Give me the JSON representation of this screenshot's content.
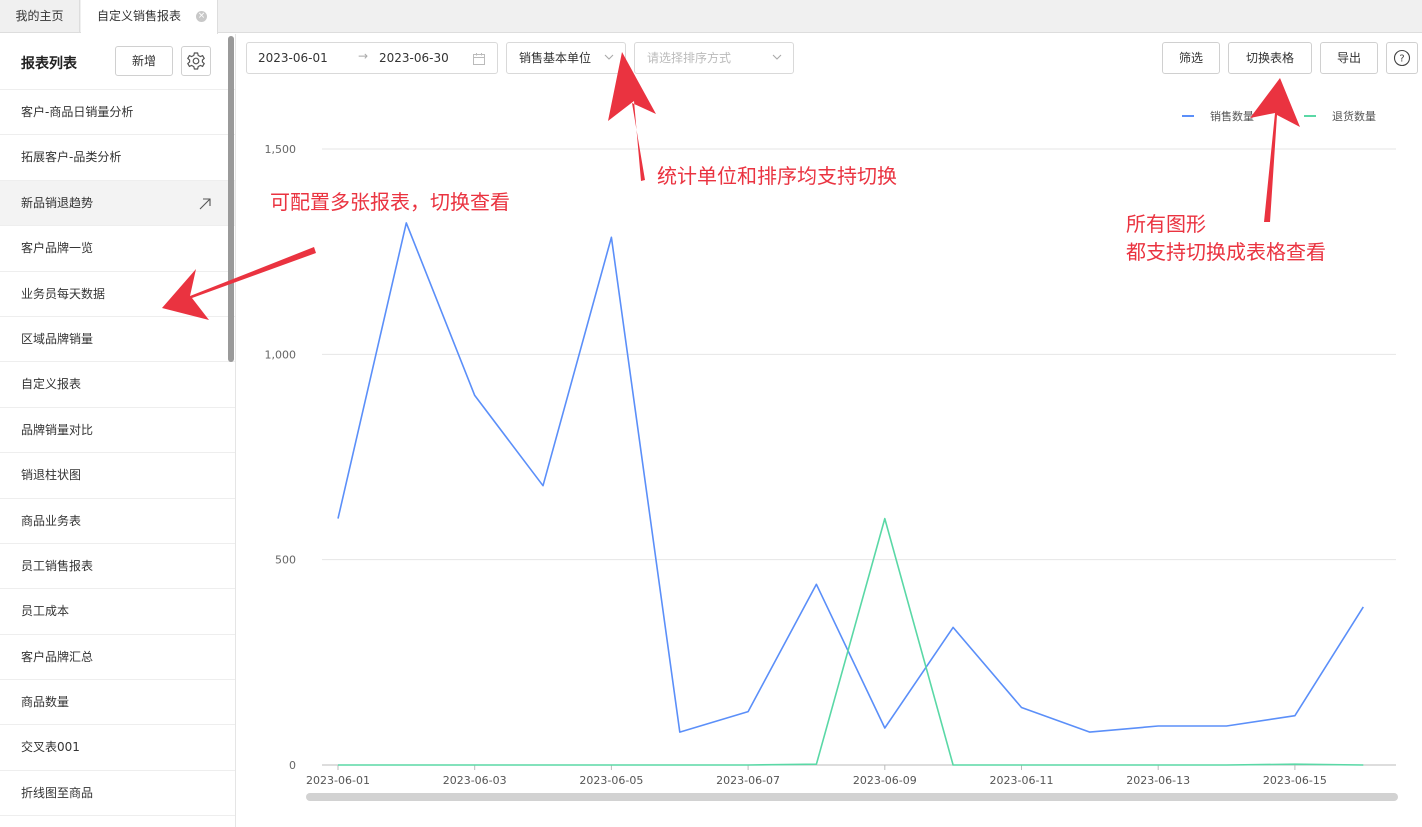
{
  "tabs": [
    {
      "label": "我的主页"
    },
    {
      "label": "自定义销售报表",
      "close": "×"
    }
  ],
  "sidebar": {
    "title": "报表列表",
    "new_label": "新增",
    "items": [
      {
        "label": "客户-商品日销量分析"
      },
      {
        "label": "拓展客户-品类分析"
      },
      {
        "label": "新品销退趋势"
      },
      {
        "label": "客户品牌一览"
      },
      {
        "label": "业务员每天数据"
      },
      {
        "label": "区域品牌销量"
      },
      {
        "label": "自定义报表"
      },
      {
        "label": "品牌销量对比"
      },
      {
        "label": "销退柱状图"
      },
      {
        "label": "商品业务表"
      },
      {
        "label": "员工销售报表"
      },
      {
        "label": "员工成本"
      },
      {
        "label": "客户品牌汇总"
      },
      {
        "label": "商品数量"
      },
      {
        "label": "交叉表001"
      },
      {
        "label": "折线图至商品"
      }
    ]
  },
  "toolbar": {
    "date_start": "2023-06-01",
    "date_arrow": "→",
    "date_end": "2023-06-30",
    "unit_value": "销售基本单位",
    "sort_placeholder": "请选择排序方式",
    "filter_label": "筛选",
    "switch_table_label": "切换表格",
    "export_label": "导出",
    "help_label": "?"
  },
  "colors": {
    "sales": "#5b8ff9",
    "returns": "#5ad8a6",
    "annotation": "#ea3340"
  },
  "chart_data": {
    "type": "line",
    "x": [
      "2023-06-01",
      "2023-06-02",
      "2023-06-03",
      "2023-06-04",
      "2023-06-05",
      "2023-06-06",
      "2023-06-07",
      "2023-06-08",
      "2023-06-09",
      "2023-06-10",
      "2023-06-11",
      "2023-06-12",
      "2023-06-13",
      "2023-06-14",
      "2023-06-15",
      "2023-06-16"
    ],
    "x_tick_labels": [
      "2023-06-01",
      "2023-06-03",
      "2023-06-05",
      "2023-06-07",
      "2023-06-09",
      "2023-06-11",
      "2023-06-13",
      "2023-06-15"
    ],
    "y_ticks": [
      0,
      500,
      1000,
      1500
    ],
    "y_tick_labels": [
      "0",
      "500",
      "1,000",
      "1,500"
    ],
    "ylim": [
      0,
      1500
    ],
    "series": [
      {
        "name": "销售数量",
        "values": [
          600,
          1320,
          900,
          680,
          1285,
          80,
          130,
          440,
          90,
          335,
          140,
          80,
          95,
          95,
          120,
          385
        ]
      },
      {
        "name": "退货数量",
        "values": [
          0,
          0,
          0,
          0,
          0,
          0,
          0,
          2,
          600,
          0,
          0,
          0,
          0,
          0,
          2,
          0
        ]
      }
    ],
    "legend_position": "top-right",
    "grid": true
  },
  "annotations": {
    "units_and_sort": "统计单位和排序均支持切换",
    "multi_reports": "可配置多张报表，切换查看",
    "table_line1": "所有图形",
    "table_line2": "都支持切换成表格查看"
  }
}
